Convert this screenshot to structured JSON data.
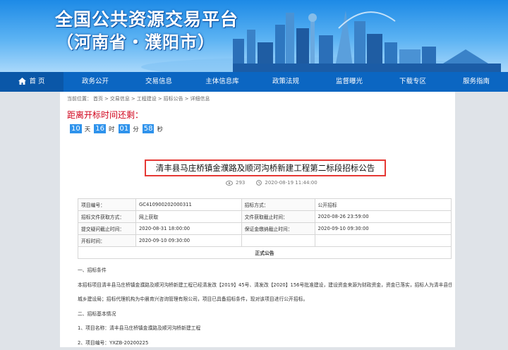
{
  "banner": {
    "title_line1": "全国公共资源交易平台",
    "title_line2": "（河南省・濮阳市）"
  },
  "nav": {
    "items": [
      "首 页",
      "政务公开",
      "交易信息",
      "主体信息库",
      "政策法规",
      "监督曝光",
      "下载专区",
      "服务指南"
    ]
  },
  "breadcrumb": {
    "prefix": "当前位置：",
    "items": [
      "首页",
      "交易信息",
      "工程建设",
      "招标公告",
      "详细信息"
    ],
    "sep": ">"
  },
  "countdown": {
    "title": "距离开标时间还剩：",
    "days": "10",
    "days_unit": "天",
    "hours": "16",
    "hours_unit": "时",
    "minutes": "01",
    "minutes_unit": "分",
    "seconds": "58",
    "seconds_unit": "秒"
  },
  "notice": {
    "title": "清丰县马庄桥镇金濮路及顺河沟桥新建工程第二标段招标公告",
    "views": "293",
    "date": "2020-08-19 11:44:00"
  },
  "info_table": {
    "rows": [
      [
        "项目编号：",
        "GC410900202000311",
        "招标方式：",
        "公开招标"
      ],
      [
        "招标文件获取方式：",
        "网上获取",
        "文件获取截止时间：",
        "2020-08-26 23:59:00"
      ],
      [
        "提交疑问截止时间：",
        "2020-08-31 18:00:00",
        "保证金缴纳截止时间：",
        "2020-09-10 09:30:00"
      ],
      [
        "开标时间：",
        "2020-09-10 09:30:00",
        "",
        ""
      ]
    ],
    "footer": "正式公告"
  },
  "body": {
    "lines": [
      "一、招标条件",
      "本招标项目清丰县马庄桥镇金濮路及顺河沟桥新建工程已经清发改【2019】45号、清发改【2020】156号批准建设，建设资金来源为财政资金，资金已落实，招标人为清丰县住房和",
      "城乡建设局；招标代理机构为中晨育兴咨询管理有限公司，项目已具备招标条件，现对该项目进行公开招标。",
      "二、招标基本情况",
      "1、项目名称：清丰县马庄桥镇金濮路及顺河沟桥新建工程",
      "2、项目编号：YXZB-20200225"
    ]
  },
  "colors": {
    "nav": "#0b66c2",
    "accent_red": "#d0021b",
    "countdown_box": "#2f93ec"
  }
}
